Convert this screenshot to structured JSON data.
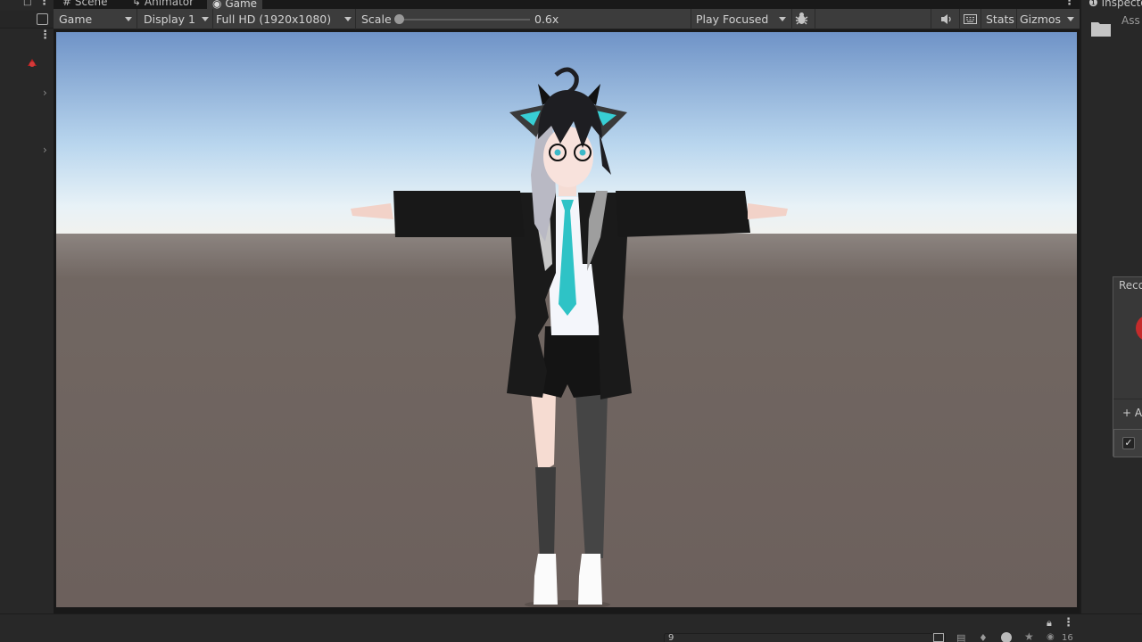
{
  "tabs": [
    {
      "label": "Scene",
      "icon": "hash-icon"
    },
    {
      "label": "Animator",
      "icon": "animator-icon"
    },
    {
      "label": "Game",
      "icon": "gamepad-icon"
    }
  ],
  "toolbar": {
    "view_mode": "Game",
    "display": "Display 1",
    "resolution": "Full HD (1920x1080)",
    "scale_label": "Scale",
    "scale_value": "0.6x",
    "play_mode": "Play Focused",
    "stats_label": "Stats",
    "gizmos_label": "Gizmos"
  },
  "inspector": {
    "tab_label": "Inspecto",
    "assets_label": "Ass",
    "recorder_label": "Reco",
    "add_label": "+ Ac"
  },
  "bottom": {
    "search_value": "9",
    "count": "16"
  },
  "colors": {
    "accent": "#3a79bb",
    "record_red": "#c42b2b",
    "panel": "#282828",
    "toolbar": "#3c3c3c",
    "tie_cyan": "#2ec3c6"
  }
}
